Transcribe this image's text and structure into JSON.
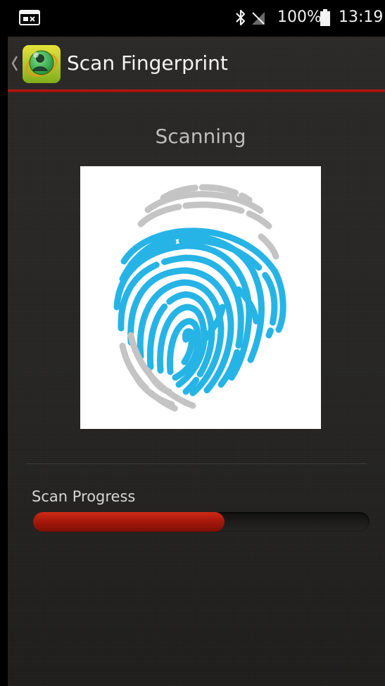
{
  "status_bar": {
    "notification_icon": "contact-card-icon",
    "bluetooth_icon": "bluetooth-icon",
    "signal_icon": "no-sim-icon",
    "battery_text": "100%",
    "battery_icon": "battery-full-icon",
    "time": "13:19"
  },
  "action_bar": {
    "back_icon": "chevron-left-icon",
    "app_icon": "app-logo-icon",
    "title": "Scan Fingerprint",
    "accent_color": "#c21a12"
  },
  "main": {
    "status_text": "Scanning",
    "fingerprint": {
      "icon": "fingerprint-icon",
      "scanned_color": "#26b4e6",
      "unscanned_color": "#c4c4c4",
      "background": "#ffffff"
    },
    "progress": {
      "label": "Scan Progress",
      "value": 0.57,
      "fill_color": "#b51c0e"
    }
  }
}
